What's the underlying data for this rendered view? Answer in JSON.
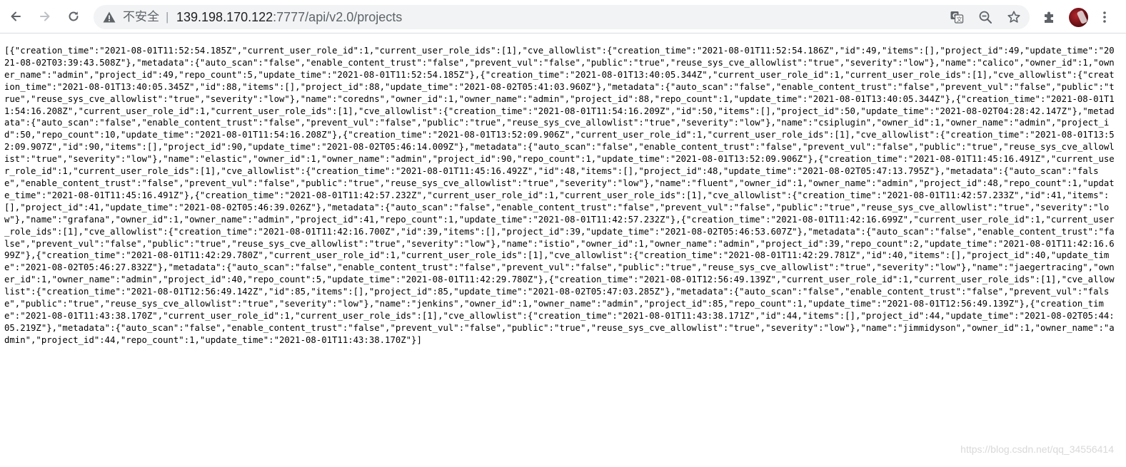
{
  "browser": {
    "security_label": "不安全",
    "url_host": "139.198.170.122",
    "url_path": ":7777/api/v2.0/projects",
    "icons": [
      "back-arrow-icon",
      "forward-arrow-icon",
      "reload-icon",
      "warning-triangle-icon",
      "translate-icon",
      "zoom-out-icon",
      "bookmark-star-icon",
      "extensions-puzzle-icon",
      "menu-dots-icon"
    ]
  },
  "response": {
    "json_text": "[{\"creation_time\":\"2021-08-01T11:52:54.185Z\",\"current_user_role_id\":1,\"current_user_role_ids\":[1],\"cve_allowlist\":{\"creation_time\":\"2021-08-01T11:52:54.186Z\",\"id\":49,\"items\":[],\"project_id\":49,\"update_time\":\"2021-08-02T03:39:43.508Z\"},\"metadata\":{\"auto_scan\":\"false\",\"enable_content_trust\":\"false\",\"prevent_vul\":\"false\",\"public\":\"true\",\"reuse_sys_cve_allowlist\":\"true\",\"severity\":\"low\"},\"name\":\"calico\",\"owner_id\":1,\"owner_name\":\"admin\",\"project_id\":49,\"repo_count\":5,\"update_time\":\"2021-08-01T11:52:54.185Z\"},{\"creation_time\":\"2021-08-01T13:40:05.344Z\",\"current_user_role_id\":1,\"current_user_role_ids\":[1],\"cve_allowlist\":{\"creation_time\":\"2021-08-01T13:40:05.345Z\",\"id\":88,\"items\":[],\"project_id\":88,\"update_time\":\"2021-08-02T05:41:03.960Z\"},\"metadata\":{\"auto_scan\":\"false\",\"enable_content_trust\":\"false\",\"prevent_vul\":\"false\",\"public\":\"true\",\"reuse_sys_cve_allowlist\":\"true\",\"severity\":\"low\"},\"name\":\"coredns\",\"owner_id\":1,\"owner_name\":\"admin\",\"project_id\":88,\"repo_count\":1,\"update_time\":\"2021-08-01T13:40:05.344Z\"},{\"creation_time\":\"2021-08-01T11:54:16.208Z\",\"current_user_role_id\":1,\"current_user_role_ids\":[1],\"cve_allowlist\":{\"creation_time\":\"2021-08-01T11:54:16.209Z\",\"id\":50,\"items\":[],\"project_id\":50,\"update_time\":\"2021-08-02T04:28:42.147Z\"},\"metadata\":{\"auto_scan\":\"false\",\"enable_content_trust\":\"false\",\"prevent_vul\":\"false\",\"public\":\"true\",\"reuse_sys_cve_allowlist\":\"true\",\"severity\":\"low\"},\"name\":\"csiplugin\",\"owner_id\":1,\"owner_name\":\"admin\",\"project_id\":50,\"repo_count\":10,\"update_time\":\"2021-08-01T11:54:16.208Z\"},{\"creation_time\":\"2021-08-01T13:52:09.906Z\",\"current_user_role_id\":1,\"current_user_role_ids\":[1],\"cve_allowlist\":{\"creation_time\":\"2021-08-01T13:52:09.907Z\",\"id\":90,\"items\":[],\"project_id\":90,\"update_time\":\"2021-08-02T05:46:14.009Z\"},\"metadata\":{\"auto_scan\":\"false\",\"enable_content_trust\":\"false\",\"prevent_vul\":\"false\",\"public\":\"true\",\"reuse_sys_cve_allowlist\":\"true\",\"severity\":\"low\"},\"name\":\"elastic\",\"owner_id\":1,\"owner_name\":\"admin\",\"project_id\":90,\"repo_count\":1,\"update_time\":\"2021-08-01T13:52:09.906Z\"},{\"creation_time\":\"2021-08-01T11:45:16.491Z\",\"current_user_role_id\":1,\"current_user_role_ids\":[1],\"cve_allowlist\":{\"creation_time\":\"2021-08-01T11:45:16.492Z\",\"id\":48,\"items\":[],\"project_id\":48,\"update_time\":\"2021-08-02T05:47:13.795Z\"},\"metadata\":{\"auto_scan\":\"false\",\"enable_content_trust\":\"false\",\"prevent_vul\":\"false\",\"public\":\"true\",\"reuse_sys_cve_allowlist\":\"true\",\"severity\":\"low\"},\"name\":\"fluent\",\"owner_id\":1,\"owner_name\":\"admin\",\"project_id\":48,\"repo_count\":1,\"update_time\":\"2021-08-01T11:45:16.491Z\"},{\"creation_time\":\"2021-08-01T11:42:57.232Z\",\"current_user_role_id\":1,\"current_user_role_ids\":[1],\"cve_allowlist\":{\"creation_time\":\"2021-08-01T11:42:57.233Z\",\"id\":41,\"items\":[],\"project_id\":41,\"update_time\":\"2021-08-02T05:46:39.026Z\"},\"metadata\":{\"auto_scan\":\"false\",\"enable_content_trust\":\"false\",\"prevent_vul\":\"false\",\"public\":\"true\",\"reuse_sys_cve_allowlist\":\"true\",\"severity\":\"low\"},\"name\":\"grafana\",\"owner_id\":1,\"owner_name\":\"admin\",\"project_id\":41,\"repo_count\":1,\"update_time\":\"2021-08-01T11:42:57.232Z\"},{\"creation_time\":\"2021-08-01T11:42:16.699Z\",\"current_user_role_id\":1,\"current_user_role_ids\":[1],\"cve_allowlist\":{\"creation_time\":\"2021-08-01T11:42:16.700Z\",\"id\":39,\"items\":[],\"project_id\":39,\"update_time\":\"2021-08-02T05:46:53.607Z\"},\"metadata\":{\"auto_scan\":\"false\",\"enable_content_trust\":\"false\",\"prevent_vul\":\"false\",\"public\":\"true\",\"reuse_sys_cve_allowlist\":\"true\",\"severity\":\"low\"},\"name\":\"istio\",\"owner_id\":1,\"owner_name\":\"admin\",\"project_id\":39,\"repo_count\":2,\"update_time\":\"2021-08-01T11:42:16.699Z\"},{\"creation_time\":\"2021-08-01T11:42:29.780Z\",\"current_user_role_id\":1,\"current_user_role_ids\":[1],\"cve_allowlist\":{\"creation_time\":\"2021-08-01T11:42:29.781Z\",\"id\":40,\"items\":[],\"project_id\":40,\"update_time\":\"2021-08-02T05:46:27.832Z\"},\"metadata\":{\"auto_scan\":\"false\",\"enable_content_trust\":\"false\",\"prevent_vul\":\"false\",\"public\":\"true\",\"reuse_sys_cve_allowlist\":\"true\",\"severity\":\"low\"},\"name\":\"jaegertracing\",\"owner_id\":1,\"owner_name\":\"admin\",\"project_id\":40,\"repo_count\":5,\"update_time\":\"2021-08-01T11:42:29.780Z\"},{\"creation_time\":\"2021-08-01T12:56:49.139Z\",\"current_user_role_id\":1,\"current_user_role_ids\":[1],\"cve_allowlist\":{\"creation_time\":\"2021-08-01T12:56:49.142Z\",\"id\":85,\"items\":[],\"project_id\":85,\"update_time\":\"2021-08-02T05:47:03.285Z\"},\"metadata\":{\"auto_scan\":\"false\",\"enable_content_trust\":\"false\",\"prevent_vul\":\"false\",\"public\":\"true\",\"reuse_sys_cve_allowlist\":\"true\",\"severity\":\"low\"},\"name\":\"jenkins\",\"owner_id\":1,\"owner_name\":\"admin\",\"project_id\":85,\"repo_count\":1,\"update_time\":\"2021-08-01T12:56:49.139Z\"},{\"creation_time\":\"2021-08-01T11:43:38.170Z\",\"current_user_role_id\":1,\"current_user_role_ids\":[1],\"cve_allowlist\":{\"creation_time\":\"2021-08-01T11:43:38.171Z\",\"id\":44,\"items\":[],\"project_id\":44,\"update_time\":\"2021-08-02T05:44:05.219Z\"},\"metadata\":{\"auto_scan\":\"false\",\"enable_content_trust\":\"false\",\"prevent_vul\":\"false\",\"public\":\"true\",\"reuse_sys_cve_allowlist\":\"true\",\"severity\":\"low\"},\"name\":\"jimmidyson\",\"owner_id\":1,\"owner_name\":\"admin\",\"project_id\":44,\"repo_count\":1,\"update_time\":\"2021-08-01T11:43:38.170Z\"}]"
  },
  "watermark": "https://blog.csdn.net/qq_34556414"
}
